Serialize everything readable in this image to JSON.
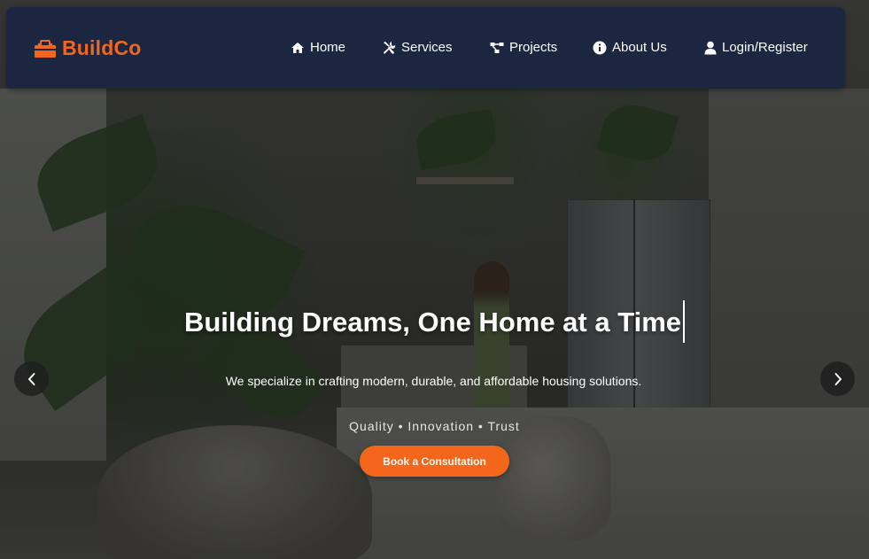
{
  "brand": {
    "name": "BuildCo",
    "color": "#f4661b",
    "icon": "toolbox-icon"
  },
  "nav": {
    "background": "#1b2640",
    "items": [
      {
        "label": "Home",
        "icon": "home-icon"
      },
      {
        "label": "Services",
        "icon": "tools-icon"
      },
      {
        "label": "Projects",
        "icon": "project-diagram-icon"
      },
      {
        "label": "About Us",
        "icon": "info-circle-icon"
      },
      {
        "label": "Login/Register",
        "icon": "user-icon"
      }
    ]
  },
  "hero": {
    "title": "Building Dreams, One Home at a Time",
    "subtitle": "We specialize in crafting modern, durable, and affordable housing solutions.",
    "tagline": "Quality • Innovation • Trust",
    "cta_label": "Book a Consultation",
    "cta_color": "#f4661b"
  },
  "carousel": {
    "prev_icon": "chevron-left-icon",
    "next_icon": "chevron-right-icon"
  }
}
